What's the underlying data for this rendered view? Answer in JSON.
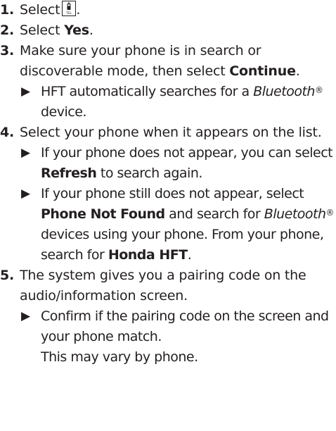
{
  "steps": [
    {
      "number": "1.",
      "text_before_icon": "Select",
      "icon": "tel-phone-icon",
      "text_after_icon": "."
    },
    {
      "number": "2.",
      "text": "Select",
      "bold": "Yes",
      "end": "."
    },
    {
      "number": "3.",
      "text": "Make sure your phone is in search or discoverable mode, then select",
      "bold": "Continue",
      "end": ".",
      "notes": [
        {
          "text_before": "HFT automatically searches for a",
          "italic": "Bluetooth",
          "reg": "®",
          "text_after": "device."
        }
      ]
    },
    {
      "number": "4.",
      "text": "Select your phone when it appears on the list.",
      "notes": [
        {
          "text_before": "If your phone does not appear, you can select",
          "bold": "Refresh",
          "text_after": "to search again."
        },
        {
          "text_before": "If your phone still does not appear, select",
          "bold": "Phone Not Found",
          "text_mid": "and search for",
          "italic": "Bluetooth",
          "reg": "®",
          "text_mid2": "devices using your phone. From your phone, search for",
          "bold2": "Honda HFT",
          "end": "."
        }
      ]
    },
    {
      "number": "5.",
      "text": "The system gives you a pairing code on the audio/information screen.",
      "notes": [
        {
          "text_before": "Confirm if the pairing code on the screen and your phone match.",
          "text_after": "This may vary by phone."
        }
      ]
    }
  ],
  "icon_label": "TEL",
  "arrow_glyph": "▶"
}
